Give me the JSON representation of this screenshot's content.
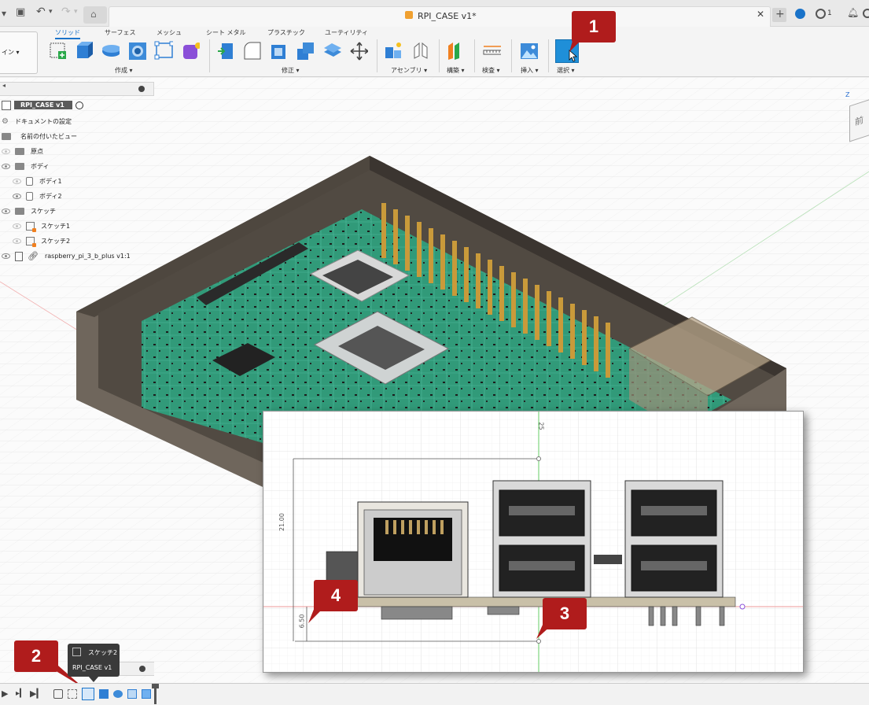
{
  "window": {
    "document_title": "RPI_CASE v1*",
    "notification_count": "1"
  },
  "workspace": {
    "label": "イン ▾"
  },
  "ribbon": {
    "tabs": [
      {
        "label": "ソリッド",
        "active": true
      },
      {
        "label": "サーフェス",
        "active": false
      },
      {
        "label": "メッシュ",
        "active": false
      },
      {
        "label": "シート メタル",
        "active": false
      },
      {
        "label": "プラスチック",
        "active": false
      },
      {
        "label": "ユーティリティ",
        "active": false
      }
    ],
    "groups": {
      "create": "作成 ▾",
      "modify": "修正 ▾",
      "assemble": "アセンブリ ▾",
      "construct": "構築 ▾",
      "inspect": "検査 ▾",
      "insert": "挿入 ▾",
      "select": "選択 ▾"
    }
  },
  "browser": {
    "root": "RPI_CASE v1",
    "items": [
      {
        "label": "ドキュメントの設定",
        "kind": "gear"
      },
      {
        "label": "名前の付いたビュー",
        "kind": "folder"
      },
      {
        "label": "原点",
        "kind": "folder"
      },
      {
        "label": "ボディ",
        "kind": "folder"
      },
      {
        "label": "ボディ1",
        "kind": "body"
      },
      {
        "label": "ボディ2",
        "kind": "body"
      },
      {
        "label": "スケッチ",
        "kind": "folder"
      },
      {
        "label": "スケッチ1",
        "kind": "sketch"
      },
      {
        "label": "スケッチ2",
        "kind": "sketch"
      },
      {
        "label": "raspberry_pi_3_b_plus v1:1",
        "kind": "link"
      }
    ]
  },
  "viewcube": {
    "face": "前",
    "axis": "Z"
  },
  "inset": {
    "dim_height": "21.00",
    "dim_offset": "6.50",
    "dim_top": "25"
  },
  "timeline": {
    "tooltip_title": "スケッチ2",
    "tooltip_sub": "RPI_CASE v1"
  },
  "callouts": [
    "1",
    "2",
    "3",
    "4"
  ],
  "colors": {
    "accent": "#1a73c9",
    "callout": "#b01c1c",
    "pcb": "#2f9e7c",
    "case": "#6f665c"
  }
}
